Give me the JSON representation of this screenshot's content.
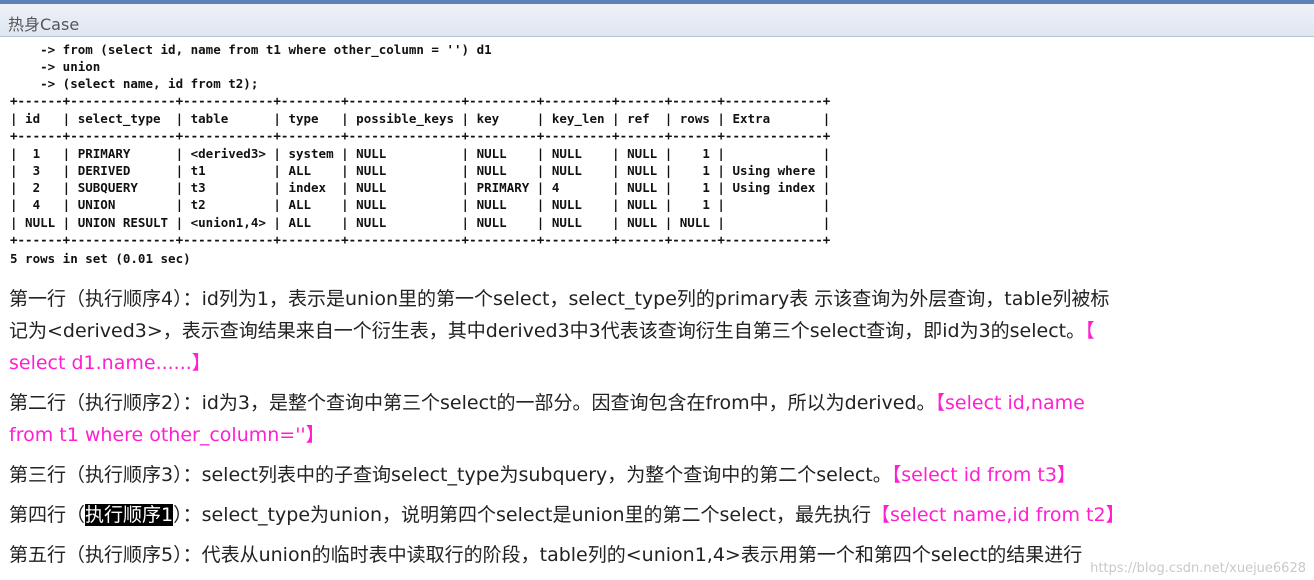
{
  "window": {
    "title": "热身Case"
  },
  "console": {
    "query_lines": [
      "    -> from (select id, name from t1 where other_column = '') d1",
      "    -> union",
      "    -> (select name, id from t2);"
    ],
    "table": {
      "border": "+------+--------------+------------+--------+---------------+---------+---------+------+------+-------------+",
      "header": "| id   | select_type  | table      | type   | possible_keys | key     | key_len | ref  | rows | Extra       |",
      "rows": [
        "|  1   | PRIMARY      | <derived3> | system | NULL          | NULL    | NULL    | NULL |    1 |             |",
        "|  3   | DERIVED      | t1         | ALL    | NULL          | NULL    | NULL    | NULL |    1 | Using where |",
        "|  2   | SUBQUERY     | t3         | index  | NULL          | PRIMARY | 4       | NULL |    1 | Using index |",
        "|  4   | UNION        | t2         | ALL    | NULL          | NULL    | NULL    | NULL |    1 |             |",
        "| NULL | UNION RESULT | <union1,4> | ALL    | NULL          | NULL    | NULL    | NULL | NULL |             |"
      ]
    },
    "result": "5 rows in set (0.01 sec)"
  },
  "notes": {
    "p1_line1": "第一行（执行顺序4）：id列为1，表示是union里的第一个select，select_type列的primary表 示该查询为外层查询，table列被标",
    "p1_line2": "记为<derived3>，表示查询结果来自一个衍生表，其中derived3中3代表该查询衍生自第三个select查询，即id为3的select。",
    "p1_hl_a": "【",
    "p1_hl_b": "select d1.name......】",
    "p2_line1": "第二行（执行顺序2）：id为3，是整个查询中第三个select的一部分。因查询包含在from中，所以为derived。",
    "p2_hl_a": "【select id,name",
    "p2_hl_b": "from t1 where other_column=''】",
    "p3_text": "第三行（执行顺序3）：select列表中的子查询select_type为subquery，为整个查询中的第二个select。",
    "p3_hl": "【select id from t3】",
    "p4_pre": "第四行（",
    "p4_sel": "执行顺序1",
    "p4_post": "）：select_type为union，说明第四个select是union里的第二个select，最先执行",
    "p4_hl": "【select name,id from t2】",
    "p5_text": "第五行（执行顺序5）：代表从union的临时表中读取行的阶段，table列的<union1,4>表示用第一个和第四个select的结果进行"
  },
  "watermark": "https://blog.csdn.net/xuejue6628",
  "colors": {
    "highlight": "#ff1fd0",
    "titlebar_border": "#5b82b8"
  }
}
